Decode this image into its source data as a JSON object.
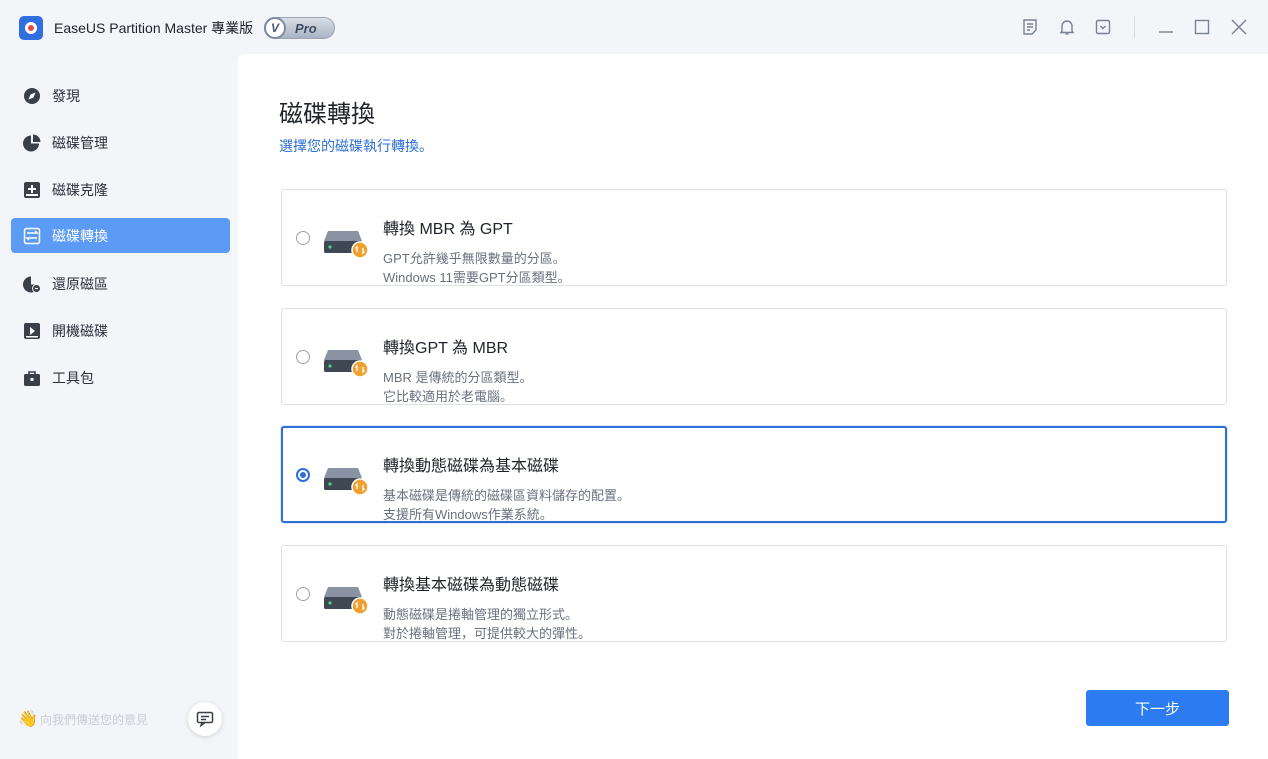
{
  "titlebar": {
    "app_title": "EaseUS Partition Master 專業版",
    "badge_v": "V",
    "badge_text": "Pro"
  },
  "sidebar": {
    "items": [
      {
        "label": "發現",
        "icon": "compass-icon"
      },
      {
        "label": "磁碟管理",
        "icon": "pie-chart-icon"
      },
      {
        "label": "磁碟克隆",
        "icon": "clone-icon"
      },
      {
        "label": "磁碟轉換",
        "icon": "convert-icon",
        "active": true
      },
      {
        "label": "還原磁區",
        "icon": "recover-icon"
      },
      {
        "label": "開機磁碟",
        "icon": "boot-disk-icon"
      },
      {
        "label": "工具包",
        "icon": "toolbox-icon"
      }
    ],
    "footer_text": "向我們傳送您的意見"
  },
  "main": {
    "title": "磁碟轉換",
    "subtitle": "選擇您的磁碟執行轉換。",
    "options": [
      {
        "title": "轉換 MBR 為 GPT",
        "line1": "GPT允許幾乎無限數量的分區。",
        "line2": "Windows 11需要GPT分區類型。",
        "selected": false
      },
      {
        "title": "轉換GPT 為 MBR",
        "line1": "MBR 是傳統的分區類型。",
        "line2": "它比較適用於老電腦。",
        "selected": false
      },
      {
        "title": "轉換動態磁碟為基本磁碟",
        "line1": "基本磁碟是傳統的磁碟區資料儲存的配置。",
        "line2": "支援所有Windows作業系統。",
        "selected": true
      },
      {
        "title": "轉換基本磁碟為動態磁碟",
        "line1": "動態磁碟是捲軸管理的獨立形式。",
        "line2": "對於捲軸管理，可提供較大的彈性。",
        "selected": false
      }
    ],
    "next_label": "下一步"
  },
  "colors": {
    "accent": "#2c7bf0",
    "sidebar_active": "#5b9bf5",
    "subtitle": "#2e6fd6",
    "disk_badge": "#f0a030"
  }
}
